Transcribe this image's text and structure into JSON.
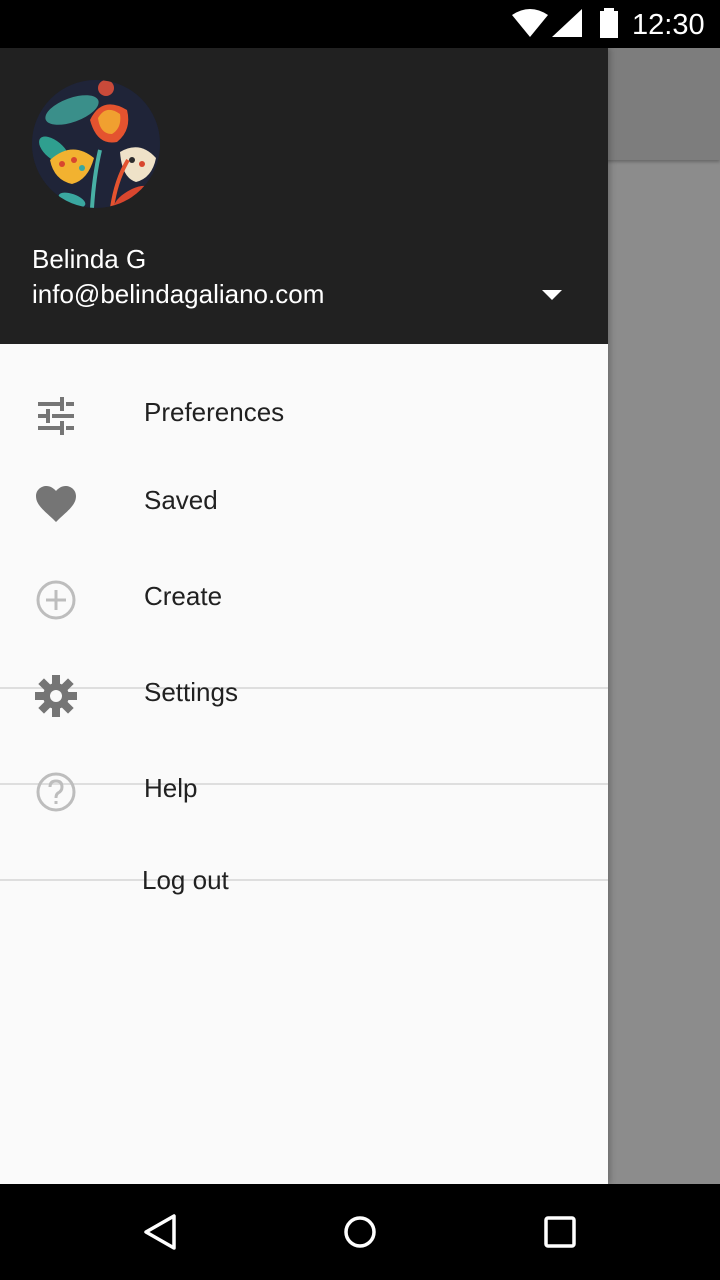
{
  "status_bar": {
    "time": "12:30",
    "icons": [
      "wifi-icon",
      "cell-signal-icon",
      "battery-icon"
    ]
  },
  "account": {
    "name": "Belinda G",
    "email": "info@belindagaliano.com",
    "avatar": "floral-artwork-avatar"
  },
  "menu": {
    "items": [
      {
        "label": "Preferences",
        "icon": "tune-sliders-icon"
      },
      {
        "label": "Saved",
        "icon": "heart-icon"
      },
      {
        "label": "Create",
        "icon": "add-circle-icon"
      },
      {
        "label": "Settings",
        "icon": "gear-icon"
      },
      {
        "label": "Help",
        "icon": "help-circle-icon"
      },
      {
        "label": "Log out",
        "icon": ""
      }
    ]
  },
  "nav_bar": {
    "buttons": [
      "back-icon",
      "home-icon",
      "recents-icon"
    ]
  },
  "colors": {
    "header_bg": "#212121",
    "drawer_bg": "#fafafa",
    "scrim": "#8c8c8c",
    "icon_gray": "#757575",
    "text_primary": "#212121"
  }
}
